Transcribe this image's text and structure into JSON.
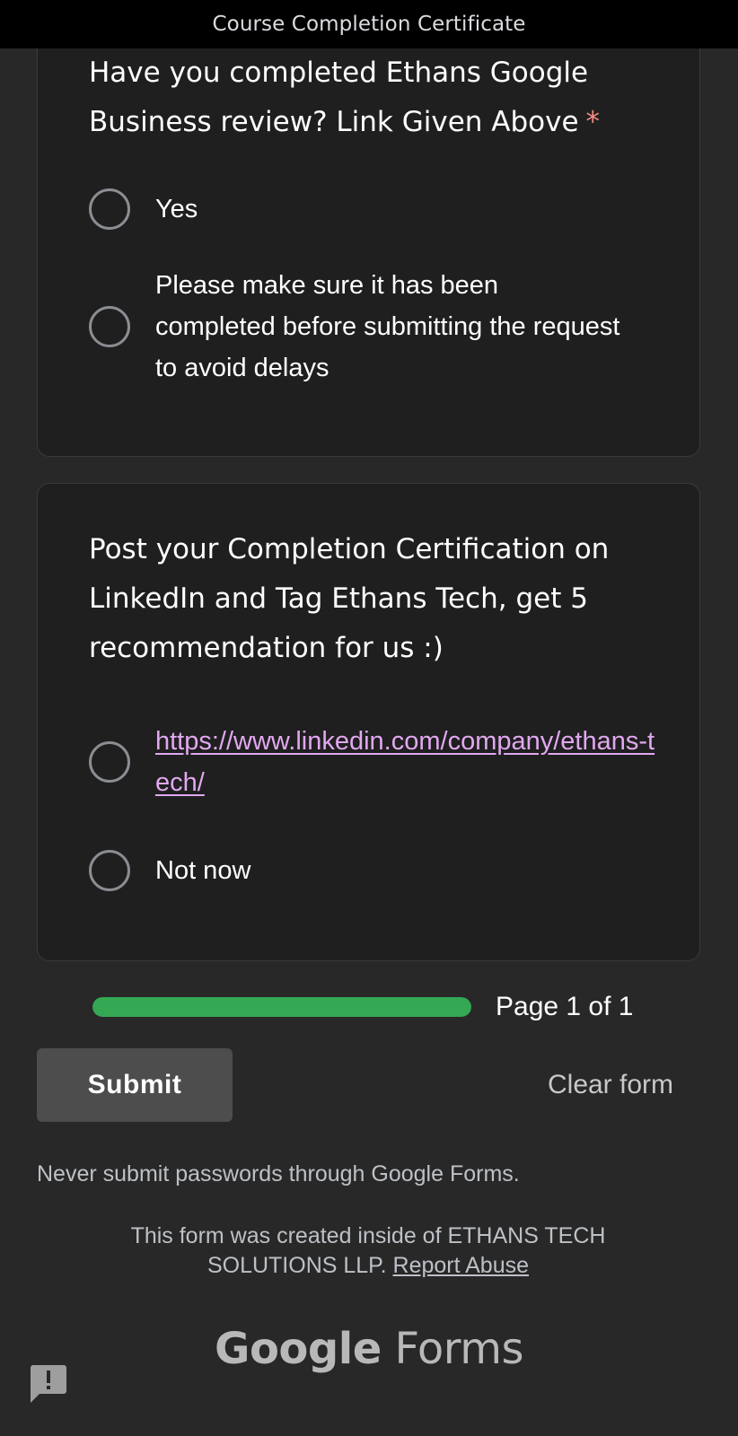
{
  "header": {
    "title": "Course Completion Certificate"
  },
  "questions": [
    {
      "text": "Have you completed Ethans Google Business review? Link Given Above",
      "required_mark": "*",
      "options": [
        {
          "label": "Yes"
        },
        {
          "label": "Please make sure it has been completed before submitting the request to avoid delays"
        }
      ]
    },
    {
      "text": "Post your Completion Certification on LinkedIn and Tag Ethans Tech, get 5 recommendation for us :)",
      "options": [
        {
          "label": "https://www.linkedin.com/company/ethans-tech/",
          "is_link": true
        },
        {
          "label": "Not now"
        }
      ]
    }
  ],
  "progress": {
    "fraction": 1.0,
    "label": "Page 1 of 1",
    "color": "#34a853"
  },
  "actions": {
    "submit_label": "Submit",
    "clear_label": "Clear form"
  },
  "footer": {
    "warning": "Never submit passwords through Google Forms.",
    "note": "This form was created inside of ETHANS TECH SOLUTIONS LLP.",
    "report_label": "Report Abuse",
    "brand_google": "Google",
    "brand_forms": "Forms"
  },
  "icons": {
    "feedback": "feedback-icon"
  },
  "colors": {
    "background": "#282828",
    "card": "#1f1f1f",
    "required": "#f28b82",
    "link": "#e1a8f0"
  }
}
